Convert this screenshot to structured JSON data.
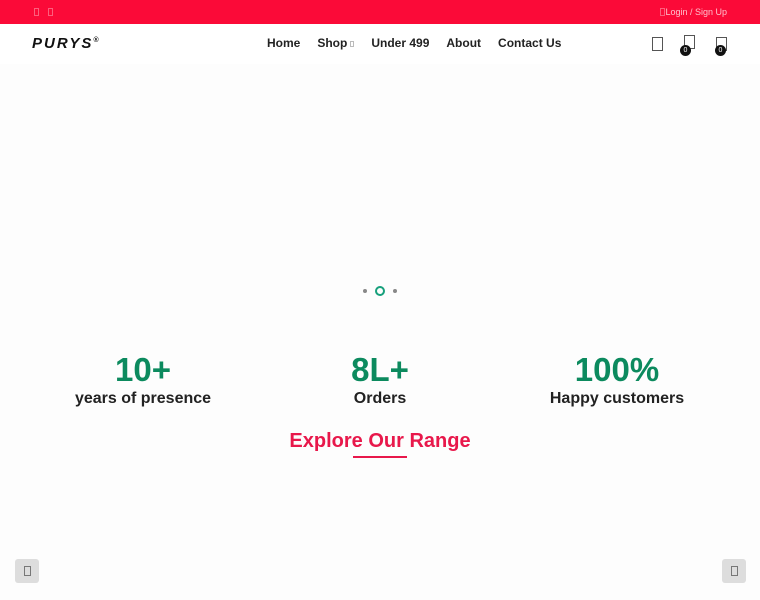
{
  "topbar": {
    "login": "Login / Sign Up"
  },
  "header": {
    "logo": "PURYS",
    "nav": [
      "Home",
      "Shop",
      "Under 499",
      "About",
      "Contact Us"
    ],
    "wishlist_count": "0",
    "cart_count": "0"
  },
  "slider": {
    "slides": 3,
    "active": 2
  },
  "stats": [
    {
      "value": "10+",
      "label": "years of presence"
    },
    {
      "value": "8L+",
      "label": "Orders"
    },
    {
      "value": "100%",
      "label": "Happy customers"
    }
  ],
  "explore": "Explore Our Range",
  "colors": {
    "topbar": "#fb0a38",
    "accent": "#0c8a5e",
    "heading": "#e8184b"
  }
}
